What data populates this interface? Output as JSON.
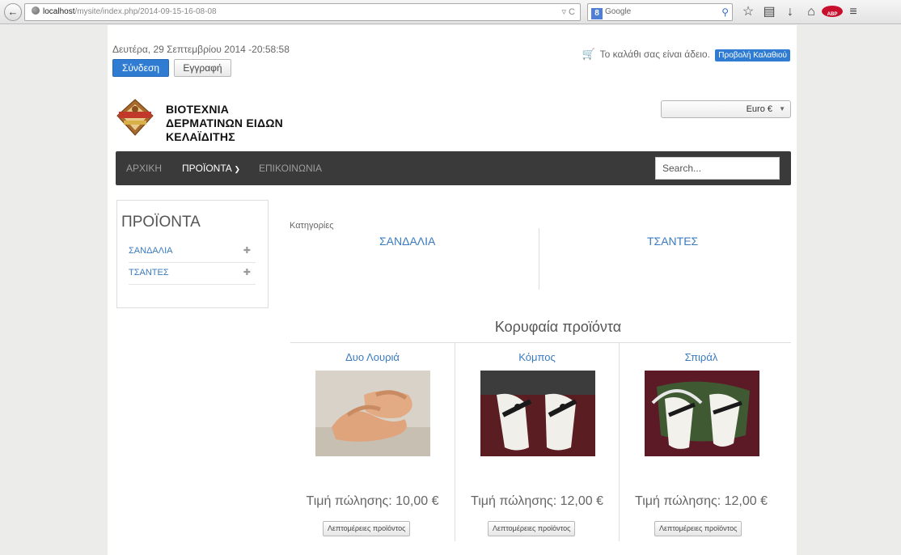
{
  "browser": {
    "url_host": "localhost",
    "url_path": "/mysite/index.php/2014-09-15-16-08-08",
    "search_engine": "Google"
  },
  "header": {
    "date": "Δευτέρα, 29 Σεπτεμβρίου 2014 -20:58:58",
    "login_label": "Σύνδεση",
    "register_label": "Εγγραφή",
    "cart_text": "Το καλάθι σας είναι άδειο.",
    "cart_button": "Προβολή Καλαθιού",
    "logo_lines": [
      "ΒΙΟΤΕΧΝΙΑ",
      "ΔΕΡΜΑΤΙΝΩΝ ΕΙΔΩΝ",
      "ΚΕΛΑΪΔΙΤΗΣ"
    ],
    "currency": "Euro €"
  },
  "nav": {
    "items": [
      "ΑΡΧΙΚΗ",
      "ΠΡΟΪΟΝΤΑ",
      "ΕΠΙΚΟΙΝΩΝΙΑ"
    ],
    "search_placeholder": "Search..."
  },
  "sidebar": {
    "title": "ΠΡΟΪΟΝΤΑ",
    "items": [
      "ΣΑΝΔΑΛΙΑ",
      "ΤΣΑΝΤΕΣ"
    ]
  },
  "categories": {
    "label": "Κατηγορίες",
    "items": [
      "ΣΑΝΔΑΛΙΑ",
      "ΤΣΑΝΤΕΣ"
    ]
  },
  "top_products": {
    "heading": "Κορυφαία προϊόντα",
    "details_label": "Λεπτομέρειες προϊόντος",
    "items": [
      {
        "name": "Δυο Λουριά",
        "price": "Τιμή πώλησης: 10,00 €"
      },
      {
        "name": "Κόμπος",
        "price": "Τιμή πώλησης: 12,00 €"
      },
      {
        "name": "Σπιράλ",
        "price": "Τιμή πώλησης: 12,00 €"
      }
    ]
  },
  "colors": {
    "accent": "#2f7cd2",
    "link": "#3a7bbf",
    "navbar": "#3a3a3a"
  }
}
